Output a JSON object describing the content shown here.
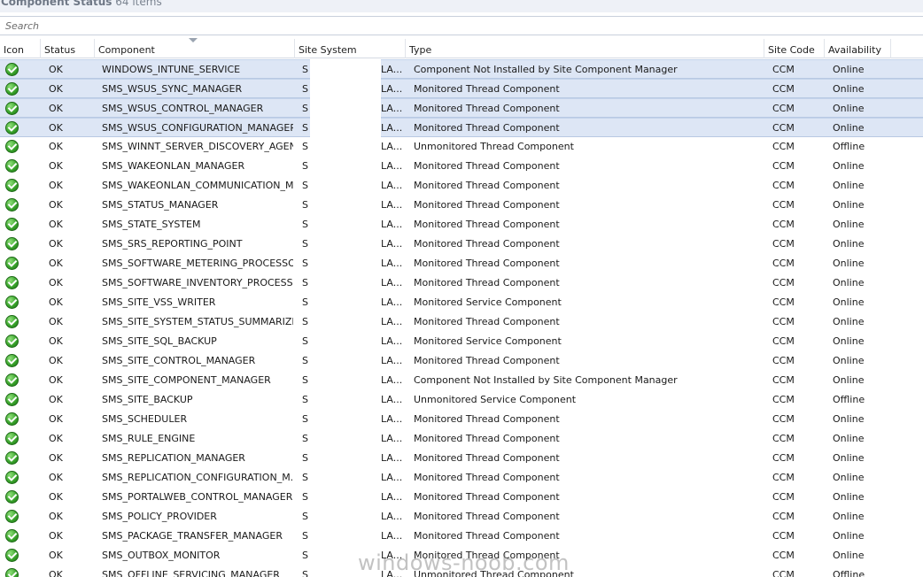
{
  "window": {
    "title": "Component Status",
    "item_count_label": "64 items"
  },
  "search": {
    "placeholder": "Search",
    "value": ""
  },
  "columns": {
    "icon": "Icon",
    "status": "Status",
    "component": "Component",
    "site_system": "Site System",
    "type": "Type",
    "site_code": "Site Code",
    "availability": "Availability"
  },
  "sort": {
    "column": "Component",
    "direction": "descending"
  },
  "colors": {
    "selected_row": "#dde6f5",
    "ok_icon": "#3aa42c",
    "header_border": "#d5dae3"
  },
  "rows": [
    {
      "icon": "ok-check-icon",
      "status": "OK",
      "component": "WINDOWS_INTUNE_SERVICE",
      "site_prefix": "S",
      "site_suffix": "LA...",
      "type": "Component Not Installed by Site Component Manager",
      "site_code": "CCM",
      "availability": "Online",
      "selected": true
    },
    {
      "icon": "ok-check-icon",
      "status": "OK",
      "component": "SMS_WSUS_SYNC_MANAGER",
      "site_prefix": "S",
      "site_suffix": "LA...",
      "type": "Monitored Thread Component",
      "site_code": "CCM",
      "availability": "Online",
      "selected": true
    },
    {
      "icon": "ok-check-icon",
      "status": "OK",
      "component": "SMS_WSUS_CONTROL_MANAGER",
      "site_prefix": "S",
      "site_suffix": "LA...",
      "type": "Monitored Thread Component",
      "site_code": "CCM",
      "availability": "Online",
      "selected": true
    },
    {
      "icon": "ok-check-icon",
      "status": "OK",
      "component": "SMS_WSUS_CONFIGURATION_MANAGER",
      "site_prefix": "S",
      "site_suffix": "LA...",
      "type": "Monitored Thread Component",
      "site_code": "CCM",
      "availability": "Online",
      "selected": true
    },
    {
      "icon": "ok-check-icon",
      "status": "OK",
      "component": "SMS_WINNT_SERVER_DISCOVERY_AGENT",
      "site_prefix": "S",
      "site_suffix": "LA...",
      "type": "Unmonitored Thread Component",
      "site_code": "CCM",
      "availability": "Offline",
      "selected": false
    },
    {
      "icon": "ok-check-icon",
      "status": "OK",
      "component": "SMS_WAKEONLAN_MANAGER",
      "site_prefix": "S",
      "site_suffix": "LA...",
      "type": "Monitored Thread Component",
      "site_code": "CCM",
      "availability": "Online",
      "selected": false
    },
    {
      "icon": "ok-check-icon",
      "status": "OK",
      "component": "SMS_WAKEONLAN_COMMUNICATION_M...",
      "site_prefix": "S",
      "site_suffix": "LA...",
      "type": "Monitored Thread Component",
      "site_code": "CCM",
      "availability": "Online",
      "selected": false
    },
    {
      "icon": "ok-check-icon",
      "status": "OK",
      "component": "SMS_STATUS_MANAGER",
      "site_prefix": "S",
      "site_suffix": "LA...",
      "type": "Monitored Thread Component",
      "site_code": "CCM",
      "availability": "Online",
      "selected": false
    },
    {
      "icon": "ok-check-icon",
      "status": "OK",
      "component": "SMS_STATE_SYSTEM",
      "site_prefix": "S",
      "site_suffix": "LA...",
      "type": "Monitored Thread Component",
      "site_code": "CCM",
      "availability": "Online",
      "selected": false
    },
    {
      "icon": "ok-check-icon",
      "status": "OK",
      "component": "SMS_SRS_REPORTING_POINT",
      "site_prefix": "S",
      "site_suffix": "LA...",
      "type": "Monitored Thread Component",
      "site_code": "CCM",
      "availability": "Online",
      "selected": false
    },
    {
      "icon": "ok-check-icon",
      "status": "OK",
      "component": "SMS_SOFTWARE_METERING_PROCESSOR",
      "site_prefix": "S",
      "site_suffix": "LA...",
      "type": "Monitored Thread Component",
      "site_code": "CCM",
      "availability": "Online",
      "selected": false
    },
    {
      "icon": "ok-check-icon",
      "status": "OK",
      "component": "SMS_SOFTWARE_INVENTORY_PROCESSOR",
      "site_prefix": "S",
      "site_suffix": "LA...",
      "type": "Monitored Thread Component",
      "site_code": "CCM",
      "availability": "Online",
      "selected": false
    },
    {
      "icon": "ok-check-icon",
      "status": "OK",
      "component": "SMS_SITE_VSS_WRITER",
      "site_prefix": "S",
      "site_suffix": "LA...",
      "type": "Monitored Service Component",
      "site_code": "CCM",
      "availability": "Online",
      "selected": false
    },
    {
      "icon": "ok-check-icon",
      "status": "OK",
      "component": "SMS_SITE_SYSTEM_STATUS_SUMMARIZER",
      "site_prefix": "S",
      "site_suffix": "LA...",
      "type": "Monitored Thread Component",
      "site_code": "CCM",
      "availability": "Online",
      "selected": false
    },
    {
      "icon": "ok-check-icon",
      "status": "OK",
      "component": "SMS_SITE_SQL_BACKUP",
      "site_prefix": "S",
      "site_suffix": "LA...",
      "type": "Monitored Service Component",
      "site_code": "CCM",
      "availability": "Online",
      "selected": false
    },
    {
      "icon": "ok-check-icon",
      "status": "OK",
      "component": "SMS_SITE_CONTROL_MANAGER",
      "site_prefix": "S",
      "site_suffix": "LA...",
      "type": "Monitored Thread Component",
      "site_code": "CCM",
      "availability": "Online",
      "selected": false
    },
    {
      "icon": "ok-check-icon",
      "status": "OK",
      "component": "SMS_SITE_COMPONENT_MANAGER",
      "site_prefix": "S",
      "site_suffix": "LA...",
      "type": "Component Not Installed by Site Component Manager",
      "site_code": "CCM",
      "availability": "Online",
      "selected": false
    },
    {
      "icon": "ok-check-icon",
      "status": "OK",
      "component": "SMS_SITE_BACKUP",
      "site_prefix": "S",
      "site_suffix": "LA...",
      "type": "Unmonitored Service Component",
      "site_code": "CCM",
      "availability": "Offline",
      "selected": false
    },
    {
      "icon": "ok-check-icon",
      "status": "OK",
      "component": "SMS_SCHEDULER",
      "site_prefix": "S",
      "site_suffix": "LA...",
      "type": "Monitored Thread Component",
      "site_code": "CCM",
      "availability": "Online",
      "selected": false
    },
    {
      "icon": "ok-check-icon",
      "status": "OK",
      "component": "SMS_RULE_ENGINE",
      "site_prefix": "S",
      "site_suffix": "LA...",
      "type": "Monitored Thread Component",
      "site_code": "CCM",
      "availability": "Online",
      "selected": false
    },
    {
      "icon": "ok-check-icon",
      "status": "OK",
      "component": "SMS_REPLICATION_MANAGER",
      "site_prefix": "S",
      "site_suffix": "LA...",
      "type": "Monitored Thread Component",
      "site_code": "CCM",
      "availability": "Online",
      "selected": false
    },
    {
      "icon": "ok-check-icon",
      "status": "OK",
      "component": "SMS_REPLICATION_CONFIGURATION_M...",
      "site_prefix": "S",
      "site_suffix": "LA...",
      "type": "Monitored Thread Component",
      "site_code": "CCM",
      "availability": "Online",
      "selected": false
    },
    {
      "icon": "ok-check-icon",
      "status": "OK",
      "component": "SMS_PORTALWEB_CONTROL_MANAGER",
      "site_prefix": "S",
      "site_suffix": "LA...",
      "type": "Monitored Thread Component",
      "site_code": "CCM",
      "availability": "Online",
      "selected": false
    },
    {
      "icon": "ok-check-icon",
      "status": "OK",
      "component": "SMS_POLICY_PROVIDER",
      "site_prefix": "S",
      "site_suffix": "LA...",
      "type": "Monitored Thread Component",
      "site_code": "CCM",
      "availability": "Online",
      "selected": false
    },
    {
      "icon": "ok-check-icon",
      "status": "OK",
      "component": "SMS_PACKAGE_TRANSFER_MANAGER",
      "site_prefix": "S",
      "site_suffix": "LA...",
      "type": "Monitored Thread Component",
      "site_code": "CCM",
      "availability": "Online",
      "selected": false
    },
    {
      "icon": "ok-check-icon",
      "status": "OK",
      "component": "SMS_OUTBOX_MONITOR",
      "site_prefix": "S",
      "site_suffix": "LA...",
      "type": "Monitored Thread Component",
      "site_code": "CCM",
      "availability": "Online",
      "selected": false
    },
    {
      "icon": "ok-check-icon",
      "status": "OK",
      "component": "SMS_OFFLINE_SERVICING_MANAGER",
      "site_prefix": "S",
      "site_suffix": "LA...",
      "type": "Unmonitored Thread Component",
      "site_code": "CCM",
      "availability": "Offline",
      "selected": false
    }
  ],
  "watermark": "windows-noob.com"
}
